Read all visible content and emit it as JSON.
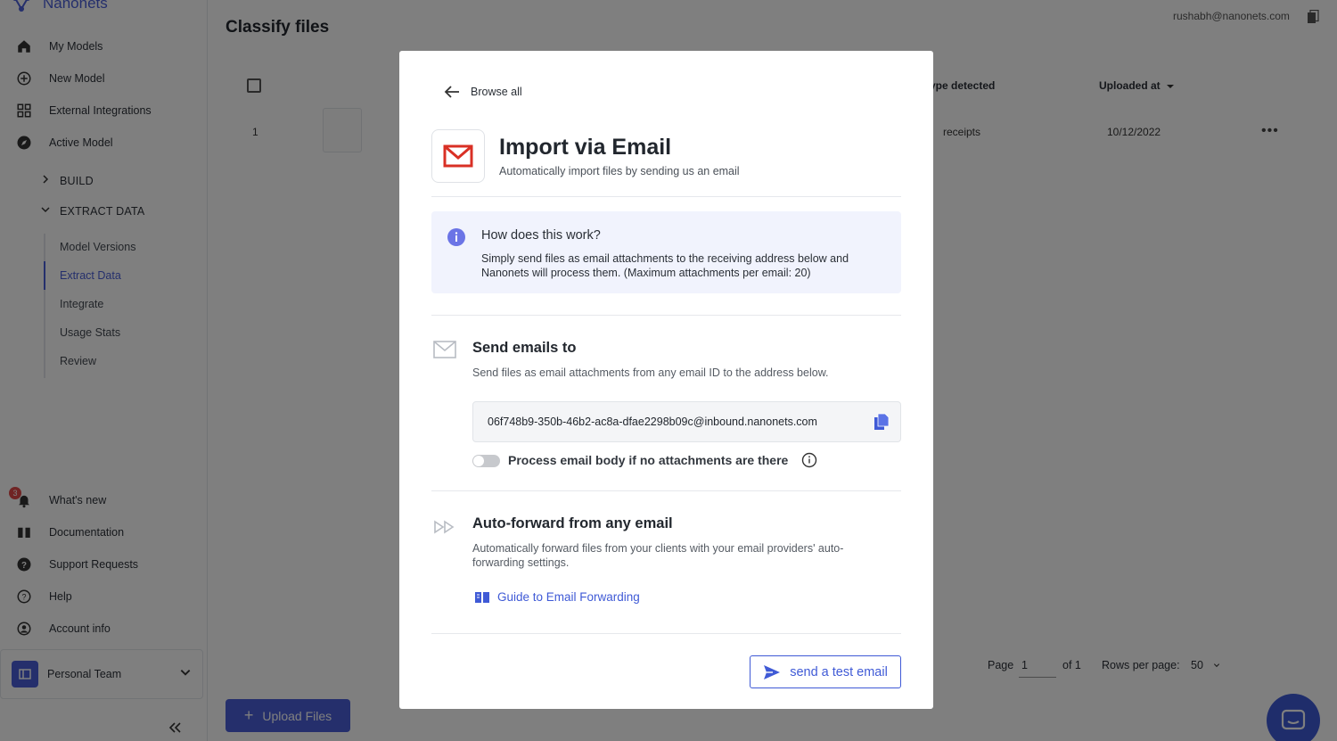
{
  "app": {
    "brand": "Nanonets",
    "page_title": "Classify files",
    "user_email": "rushabh@nanonets.com"
  },
  "sidebar": {
    "items": [
      {
        "label": "My Models",
        "icon": "home-icon"
      },
      {
        "label": "New Model",
        "icon": "plus-circle-icon"
      },
      {
        "label": "External Integrations",
        "icon": "grid-icon"
      },
      {
        "label": "Active Model",
        "icon": "compass-icon"
      }
    ],
    "build_label": "BUILD",
    "extract_label": "EXTRACT DATA",
    "sub_items": [
      "Model Versions",
      "Extract Data",
      "Integrate",
      "Usage Stats",
      "Review"
    ],
    "bottom_items": [
      {
        "label": "What's new",
        "icon": "bell-icon"
      },
      {
        "label": "Documentation",
        "icon": "book-icon"
      },
      {
        "label": "Support Requests",
        "icon": "question-circle-icon"
      },
      {
        "label": "Help",
        "icon": "help-icon"
      },
      {
        "label": "Account info",
        "icon": "user-circle-icon"
      }
    ],
    "notification_count": "3",
    "team_name": "Personal Team"
  },
  "table": {
    "headers": {
      "type_detected": "ype detected",
      "uploaded_at": "Uploaded at"
    },
    "row": {
      "index": "1",
      "type": "receipts",
      "date": "10/12/2022"
    }
  },
  "pagination": {
    "page_label": "Page",
    "page_value": "1",
    "of_label": "of 1",
    "rows_label": "Rows per page:",
    "rows_value": "50"
  },
  "upload_button": "Upload Files",
  "modal": {
    "back_label": "Browse all",
    "title": "Import via Email",
    "subtitle": "Automatically import files by sending us an email",
    "info_title": "How does this work?",
    "info_body": "Simply send files as email attachments to the receiving address below and Nanonets will process them. (Maximum attachments per email: 20)",
    "send_title": "Send emails to",
    "send_desc": "Send files as email attachments from any email ID to the address below.",
    "inbound_email": "06f748b9-350b-46b2-ac8a-dfae2298b09c@inbound.nanonets.com",
    "toggle_label": "Process email body if no attachments are there",
    "toggle_on": false,
    "forward_title": "Auto-forward from any email",
    "forward_desc": "Automatically forward files from your clients with your email providers' auto-forwarding settings.",
    "guide_link": "Guide to Email Forwarding",
    "test_button": "send a test email"
  },
  "colors": {
    "accent": "#4a5fd8",
    "gmail_red": "#d93025",
    "info_bg": "#f1f3fd",
    "badge": "#e04848"
  }
}
